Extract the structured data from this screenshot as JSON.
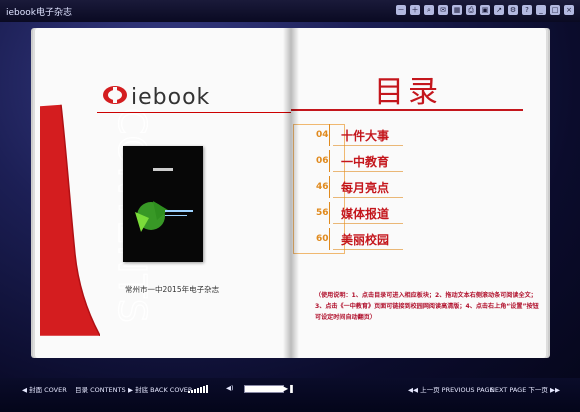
{
  "window": {
    "title": "iebook电子杂志"
  },
  "toolbar": {
    "icons": [
      "zoom-out",
      "zoom-in",
      "search",
      "chat",
      "grid",
      "print",
      "save",
      "share",
      "settings",
      "help",
      "minimize",
      "maximize",
      "close"
    ]
  },
  "left_page": {
    "logo_text": "iebook",
    "contents_label": "CONTENTS",
    "cover_caption": "常州市一中2015年电子杂志"
  },
  "right_page": {
    "toc_title": "目录",
    "toc_items": [
      {
        "num": "04",
        "name": "十件大事"
      },
      {
        "num": "06",
        "name": "一中教育"
      },
      {
        "num": "46",
        "name": "每月亮点"
      },
      {
        "num": "56",
        "name": "媒体报道"
      },
      {
        "num": "60",
        "name": "美丽校园"
      }
    ],
    "instruction": "（使用说明：1、点击目录可进入相应板块；2、拖动文本右侧滚动条可阅读全文；3、点击《一中教育》页面可链接到校园网阅读高清版；4、点击右上角“设置”按钮可设定时间自动翻页）"
  },
  "bottom_bar": {
    "cover": "封面 COVER",
    "contents": "目录 CONTENTS",
    "back_cover": "封底 BACK COVER",
    "prev": "上一页 PREVIOUS PAGE",
    "next": "NEXT PAGE 下一页"
  }
}
